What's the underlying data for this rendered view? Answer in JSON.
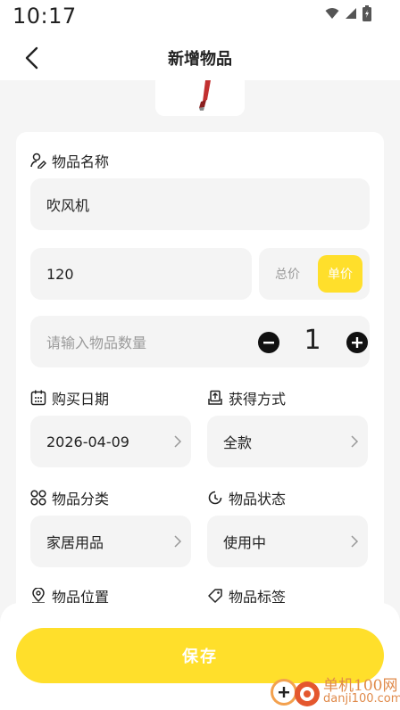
{
  "status_bar": {
    "time": "10:17"
  },
  "header": {
    "title": "新增物品"
  },
  "form": {
    "name_label": "物品名称",
    "name_value": "吹风机",
    "price_value": "120",
    "price_toggle": {
      "total": "总价",
      "unit": "单价",
      "selected": "单价"
    },
    "quantity_placeholder": "请输入物品数量",
    "quantity_value": "1",
    "purchase_date_label": "购买日期",
    "purchase_date_value": "2026-04-09",
    "acquire_method_label": "获得方式",
    "acquire_method_value": "全款",
    "category_label": "物品分类",
    "category_value": "家居用品",
    "status_label": "物品状态",
    "status_value": "使用中",
    "location_label": "物品位置",
    "tags_label": "物品标签"
  },
  "save_label": "保存",
  "watermark": {
    "line1": "单机100网",
    "line2": "danji100.com"
  },
  "colors": {
    "accent": "#ffdf2b",
    "background": "#f5f5f5",
    "field": "#f4f4f4"
  }
}
